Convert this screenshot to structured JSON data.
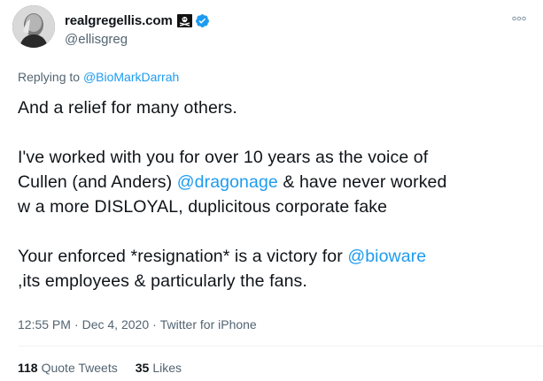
{
  "tweet": {
    "display_name": "realgregellis.com",
    "handle": "@ellisgreg",
    "replying_prefix": "Replying to",
    "replying_to": "@BioMarkDarrah",
    "lines": {
      "l1": "And a relief for many others.",
      "p2a": "I've worked with you for over 10 years as the voice of",
      "p2b_pre": "Cullen (and Anders) ",
      "p2b_mention": "@dragonage",
      "p2b_post": " & have never worked",
      "p2c": "w a more DISLOYAL, duplicitous corporate fake",
      "p3a_pre": "Your enforced *resignation* is a victory for ",
      "p3a_mention": "@bioware",
      "p3b": ",its employees & particularly the fans."
    },
    "time": "12:55 PM",
    "date": "Dec 4, 2020",
    "source": "Twitter for iPhone",
    "meta_sep": "·",
    "stats": {
      "quote_count": "118",
      "quote_label": "Quote Tweets",
      "like_count": "35",
      "like_label": "Likes"
    }
  },
  "icons": {
    "badge": "pirate-flag-icon",
    "verified": "verified-badge-icon",
    "more": "more-options-icon"
  },
  "colors": {
    "link": "#1d9bf0",
    "secondary_text": "#536471",
    "primary_text": "#0f1419",
    "verified": "#1d9bf0"
  }
}
